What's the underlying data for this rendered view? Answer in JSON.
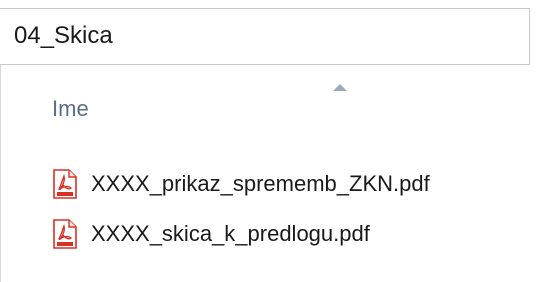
{
  "address_bar": {
    "folder_name": "04_Skica"
  },
  "file_list": {
    "column_header": "Ime",
    "sort_indicator_icon": "sort-ascending-icon",
    "files": [
      {
        "name": "XXXX_prikaz_sprememb_ZKN.pdf",
        "icon": "pdf-file-icon"
      },
      {
        "name": "XXXX_skica_k_predlogu.pdf",
        "icon": "pdf-file-icon"
      }
    ]
  },
  "colors": {
    "header_text": "#5b6f85",
    "pdf_icon_red": "#d93025",
    "sort_arrow": "#9aa9bc"
  }
}
